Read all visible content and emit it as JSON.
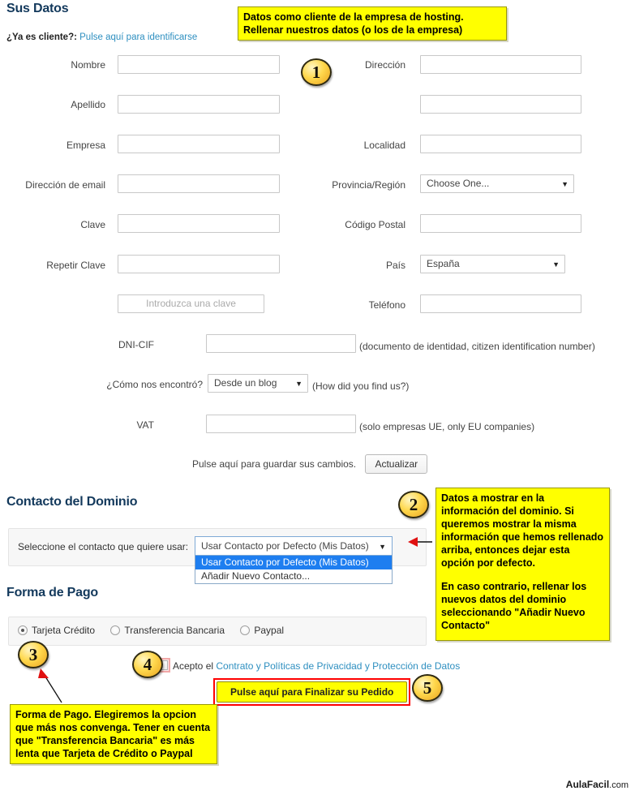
{
  "sections": {
    "sus_datos": "Sus Datos",
    "contacto_dominio": "Contacto del Dominio",
    "forma_pago": "Forma de Pago"
  },
  "client_prompt": {
    "question": "¿Ya es cliente?:",
    "link": "Pulse aquí para identificarse"
  },
  "form_left": [
    {
      "label": "Nombre",
      "value": "",
      "type": "text"
    },
    {
      "label": "Apellido",
      "value": "",
      "type": "text"
    },
    {
      "label": "Empresa",
      "value": "",
      "type": "text"
    },
    {
      "label": "Dirección de email",
      "value": "",
      "type": "text"
    },
    {
      "label": "Clave",
      "value": "",
      "type": "text"
    },
    {
      "label": "Repetir Clave",
      "value": "",
      "type": "text"
    },
    {
      "label": "",
      "value": "Introduzca una clave",
      "type": "ghost"
    }
  ],
  "form_right": [
    {
      "label": "Dirección",
      "value": "",
      "type": "text"
    },
    {
      "label": "",
      "value": "",
      "type": "text"
    },
    {
      "label": "Localidad",
      "value": "",
      "type": "text"
    },
    {
      "label": "Provincia/Región",
      "value": "Choose One...",
      "type": "select"
    },
    {
      "label": "Código Postal",
      "value": "",
      "type": "text"
    },
    {
      "label": "País",
      "value": "España",
      "type": "select"
    },
    {
      "label": "Teléfono",
      "value": "",
      "type": "text"
    }
  ],
  "form_wide": {
    "dni_label": "DNI-CIF",
    "dni_value": "",
    "dni_hint": "(documento de identidad, citizen identification number)",
    "found_label": "¿Cómo nos encontró?",
    "found_value": "Desde un blog",
    "found_hint": "(How did you find us?)",
    "vat_label": "VAT",
    "vat_value": "",
    "vat_hint": "(solo empresas UE, only EU companies)"
  },
  "save": {
    "text": "Pulse aquí para guardar sus cambios.",
    "button": "Actualizar"
  },
  "contact": {
    "select_label": "Seleccione el contacto que quiere usar:",
    "selected": "Usar Contacto por Defecto (Mis Datos)",
    "options": [
      "Usar Contacto por Defecto (Mis Datos)",
      "Añadir Nuevo Contacto..."
    ]
  },
  "payment": {
    "options": [
      {
        "label": "Tarjeta Crédito",
        "checked": true
      },
      {
        "label": "Transferencia Bancaria",
        "checked": false
      },
      {
        "label": "Paypal",
        "checked": false
      }
    ]
  },
  "accept": {
    "prefix": "Acepto el",
    "link": "Contrato y Políticas de Privacidad y Protección de Datos",
    "checked": false
  },
  "finalize_button": "Pulse aquí para Finalizar su Pedido",
  "notes": {
    "note1_line1": "Datos como cliente de la empresa de hosting.",
    "note1_line2": "Rellenar nuestros datos (o los de la empresa)",
    "note2_p1": "Datos a mostrar en la información del dominio. Si queremos mostrar la misma información que hemos rellenado arriba, entonces dejar esta opción por defecto.",
    "note2_p2": "En caso contrario, rellenar los nuevos datos del dominio seleccionando \"Añadir Nuevo Contacto\"",
    "note3": "Forma de Pago. Elegiremos la opcion que más nos convenga. Tener en cuenta que \"Transferencia Bancaria\" es más lenta que Tarjeta de Crédito o Paypal"
  },
  "badges": {
    "b1": "1",
    "b2": "2",
    "b3": "3",
    "b4": "4",
    "b5": "5"
  },
  "footer": {
    "brand": "AulaFacil",
    "tld": ".com"
  },
  "colors": {
    "heading": "#13395c",
    "link": "#2e8fc0",
    "note_bg": "#ffff00",
    "highlight": "#1e7ef0",
    "danger": "#ff0000"
  }
}
